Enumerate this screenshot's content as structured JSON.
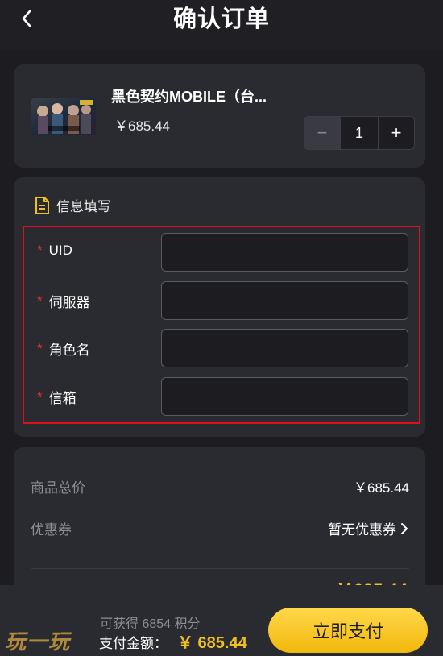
{
  "header": {
    "title": "确认订单"
  },
  "product": {
    "name": "黑色契约MOBILE（台...",
    "price": "￥685.44",
    "quantity": "1",
    "minus_symbol": "−",
    "plus_symbol": "+"
  },
  "info": {
    "title": "信息填写",
    "required_mark": "*",
    "fields": [
      {
        "label": "UID",
        "value": ""
      },
      {
        "label": "伺服器",
        "value": ""
      },
      {
        "label": "角色名",
        "value": ""
      },
      {
        "label": "信箱",
        "value": ""
      }
    ]
  },
  "summary": {
    "total_label": "商品总价",
    "total_value": "￥685.44",
    "coupon_label": "优惠券",
    "coupon_value": "暂无优惠券"
  },
  "bottom": {
    "points_text": "可获得 6854 积分",
    "pay_label": "支付金额：",
    "pay_amount": "￥ 685.44",
    "pay_button": "立即支付",
    "watermark": "玩一玩"
  },
  "colors": {
    "accent": "#f0c020",
    "required": "#e03030",
    "highlight_border": "#e0101a"
  }
}
